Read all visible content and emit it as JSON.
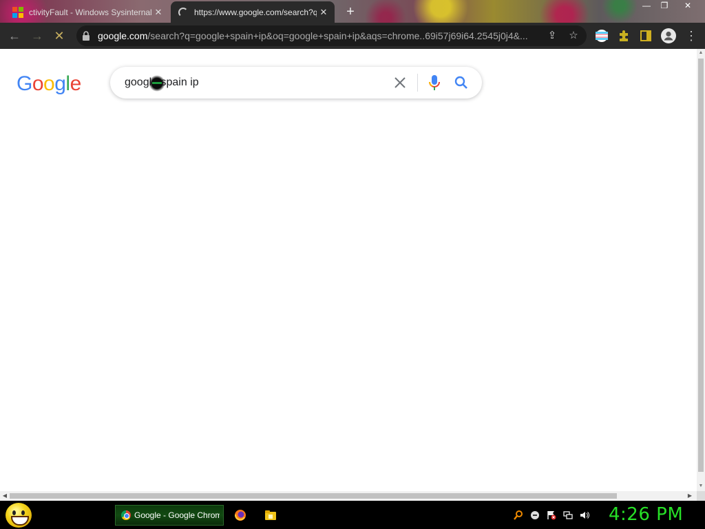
{
  "browser": {
    "tabs": [
      {
        "title": "ctivityFault - Windows Sysinternals",
        "state": "inactive"
      },
      {
        "title": "https://www.google.com/search?q=google+spain+ip",
        "state": "active-loading"
      }
    ],
    "new_tab_label": "+",
    "window_controls": {
      "minimize": "—",
      "restore": "❐",
      "close": "✕"
    },
    "toolbar": {
      "back": "←",
      "forward": "→",
      "stop": "✕",
      "url_host": "google.com",
      "url_rest": "/search?q=google+spain+ip&oq=google+spain+ip&aqs=chrome..69i57j69i64.2545j0j4&...",
      "share": "⇪",
      "bookmark": "☆",
      "menu": "⋮"
    }
  },
  "page": {
    "logo_letters": [
      "G",
      "o",
      "o",
      "g",
      "l",
      "e"
    ],
    "logo_colors": [
      "#4285F4",
      "#EA4335",
      "#FBBC05",
      "#4285F4",
      "#34A853",
      "#EA4335"
    ],
    "search": {
      "query": "google spain ip"
    }
  },
  "taskbar": {
    "active_task": "Google - Google Chrome",
    "clock": "4:26 PM"
  },
  "colors": {
    "accent_green": "#27e027",
    "toolbar_bg": "#2a2a2a",
    "omnibox_bg": "#1b1b1b"
  }
}
